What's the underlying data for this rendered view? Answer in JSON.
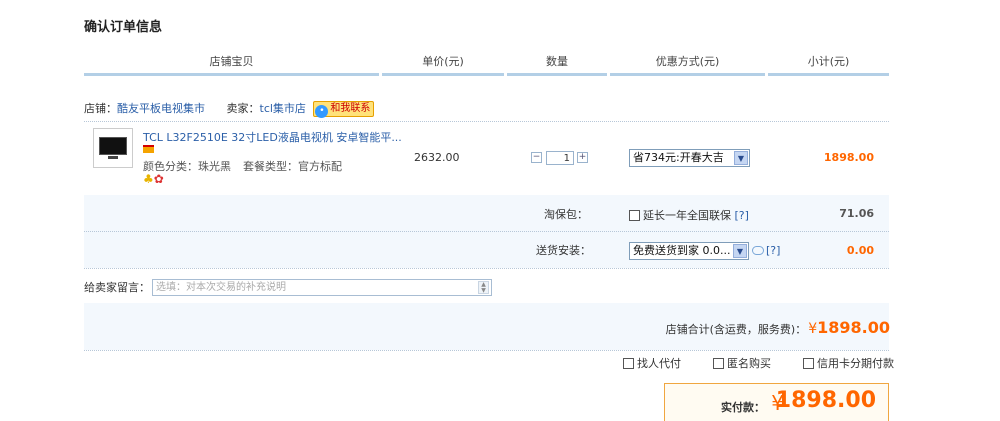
{
  "page": {
    "title": "确认订单信息"
  },
  "table": {
    "headers": [
      "店铺宝贝",
      "单价(元)",
      "数量",
      "优惠方式(元)",
      "小计(元)"
    ]
  },
  "shop": {
    "label": "店铺：",
    "name": "酷友平板电视集市",
    "seller_label": "卖家：",
    "seller_name": "tcl集市店",
    "contact_label": "和我联系"
  },
  "item": {
    "name": "TCL L32F2510E 32寸LED液晶电视机 安卓智能平...",
    "attr_color": "颜色分类：珠光黑",
    "attr_package": "套餐类型：官方标配",
    "price": "2632.00",
    "quantity": "1",
    "discount_option": "省734元:开春大吉",
    "subtotal": "1898.00"
  },
  "warranty": {
    "label": "淘保包：",
    "option": "延长一年全国联保",
    "help": "[?]",
    "amount": "71.06"
  },
  "delivery": {
    "label": "送货安装：",
    "option": "免费送货到家 0.0...",
    "help": "[?]",
    "amount": "0.00"
  },
  "message": {
    "label": "给卖家留言：",
    "placeholder": "选填：对本次交易的补充说明"
  },
  "shop_total": {
    "label": "店铺合计(含运费，服务费)：",
    "currency": "¥",
    "amount": "1898.00"
  },
  "extras": {
    "proxy_pay": "找人代付",
    "anonymous": "匿名购买",
    "installment": "信用卡分期付款"
  },
  "payment": {
    "label": "实付款：",
    "currency": "¥",
    "amount": "1898.00"
  },
  "colors": {
    "accent_orange": "#ff6600",
    "link_blue": "#2b5fa8",
    "header_border": "#b3cfe6",
    "row_bg": "#f3f8fd"
  }
}
